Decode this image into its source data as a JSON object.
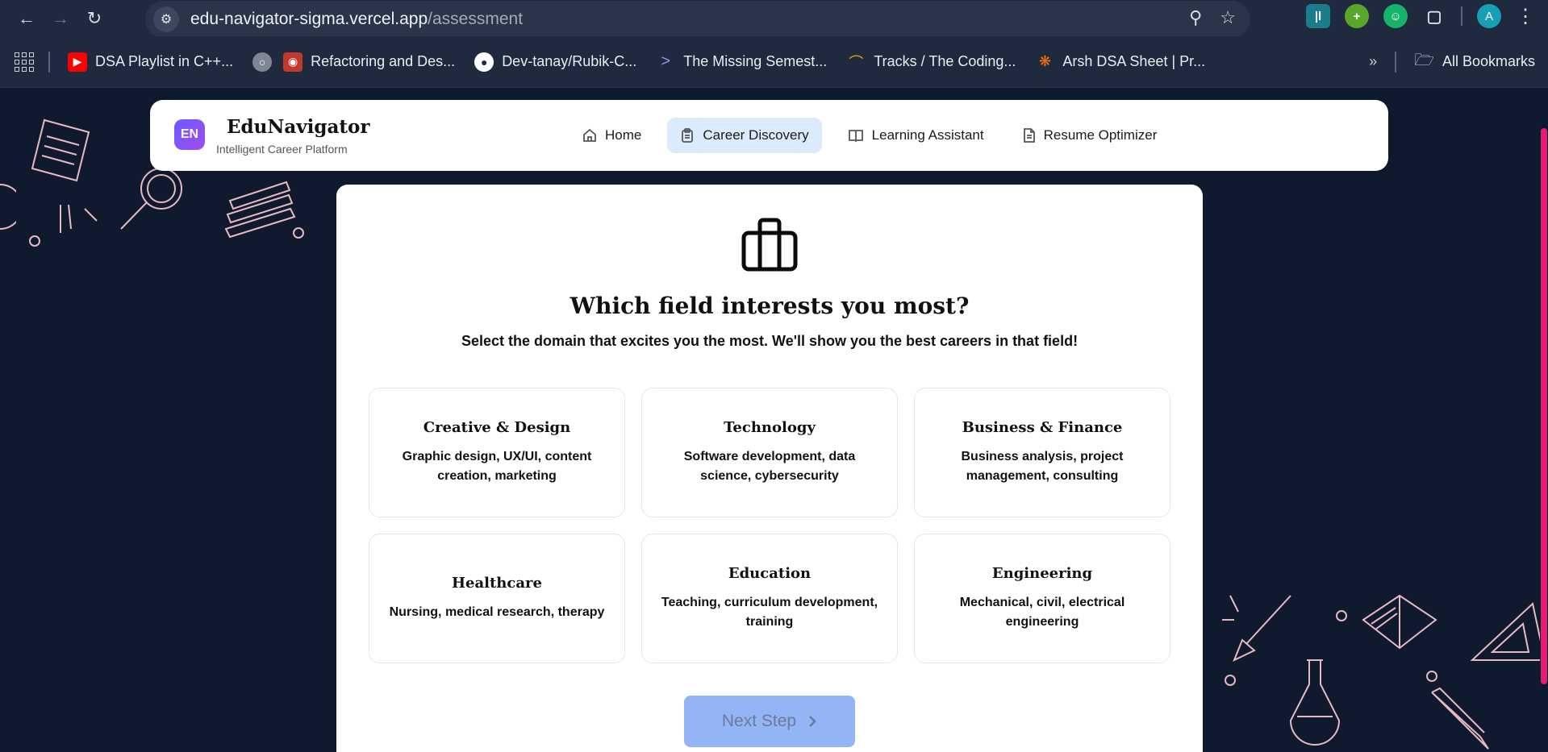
{
  "browser": {
    "url_host": "edu-navigator-sigma.vercel.app",
    "url_path": "/assessment",
    "profile_initial": "A",
    "bookmarks": [
      {
        "label": "DSA Playlist in C++...",
        "icon": "youtube-icon",
        "color": "#ff0000"
      },
      {
        "label": "",
        "icon": "globe-icon",
        "color": "#9aa3b2"
      },
      {
        "label": "Refactoring and Des...",
        "icon": "raccoon-icon",
        "color": "#c0392b"
      },
      {
        "label": "Dev-tanay/Rubik-C...",
        "icon": "github-icon",
        "color": "#ffffff"
      },
      {
        "label": "The Missing Semest...",
        "icon": "chevron-right-icon",
        "color": "#a78bfa"
      },
      {
        "label": "Tracks / The Coding...",
        "icon": "rainbow-icon",
        "color": "#f59e0b"
      },
      {
        "label": "Arsh DSA Sheet | Pr...",
        "icon": "dots-icon",
        "color": "#f97316"
      }
    ],
    "all_bookmarks_label": "All Bookmarks"
  },
  "app": {
    "logo_initials": "EN",
    "brand": "EduNavigator",
    "brand_sub": "Intelligent Career Platform",
    "nav": [
      {
        "label": "Home",
        "active": false
      },
      {
        "label": "Career Discovery",
        "active": true
      },
      {
        "label": "Learning Assistant",
        "active": false
      },
      {
        "label": "Resume Optimizer",
        "active": false
      }
    ]
  },
  "question": {
    "title": "Which field interests you most?",
    "subtitle": "Select the domain that excites you the most. We'll show you the best careers in that field!",
    "options": [
      {
        "title": "Creative & Design",
        "desc": "Graphic design, UX/UI, content creation, marketing"
      },
      {
        "title": "Technology",
        "desc": "Software development, data science, cybersecurity"
      },
      {
        "title": "Business & Finance",
        "desc": "Business analysis, project management, consulting"
      },
      {
        "title": "Healthcare",
        "desc": "Nursing, medical research, therapy"
      },
      {
        "title": "Education",
        "desc": "Teaching, curriculum development, training"
      },
      {
        "title": "Engineering",
        "desc": "Mechanical, civil, electrical engineering"
      }
    ],
    "next_label": "Next Step"
  },
  "colors": {
    "page_bg": "#0f1a2e",
    "accent": "#dbeafe",
    "button": "#93b4f5"
  }
}
